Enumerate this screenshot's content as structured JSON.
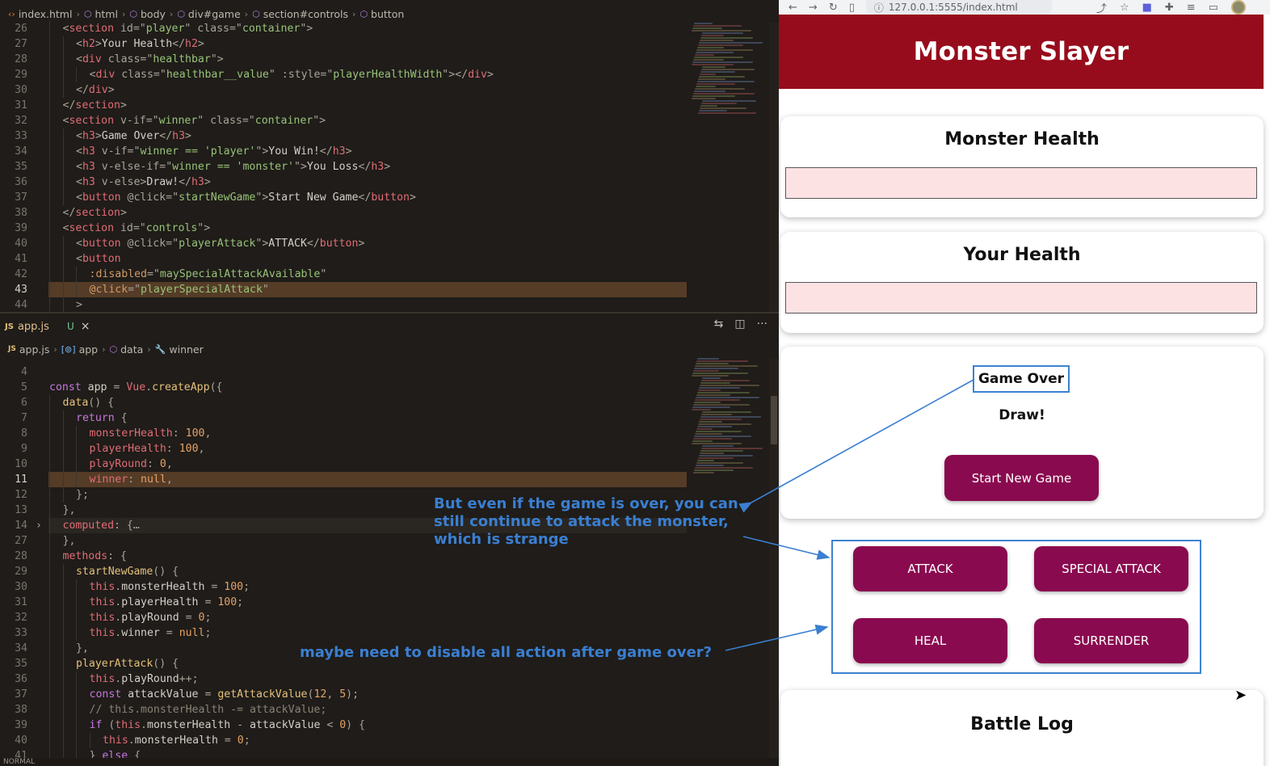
{
  "editor": {
    "top_breadcrumb": [
      {
        "icon": "html-icon",
        "label": "index.html"
      },
      {
        "icon": "box-icon",
        "label": "html"
      },
      {
        "icon": "box-icon",
        "label": "body"
      },
      {
        "icon": "box-icon",
        "label": "div#game"
      },
      {
        "icon": "box-icon",
        "label": "section#controls"
      },
      {
        "icon": "box-icon",
        "label": "button"
      }
    ],
    "html_lines": [
      {
        "n": "26",
        "code": "<section id=\"player\" class=\"container\">",
        "indent": 1
      },
      {
        "n": "27",
        "code": "<h2>Your Health</h2>",
        "indent": 2
      },
      {
        "n": "28",
        "code": "<div class=\"healthbar\">",
        "indent": 2
      },
      {
        "n": "29",
        "code": "<div class=\"healthbar__value\" :style=\"playerHealthWidth\"></div>",
        "indent": 3
      },
      {
        "n": "30",
        "code": "</div>",
        "indent": 2
      },
      {
        "n": "31",
        "code": "</section>",
        "indent": 1
      },
      {
        "n": "32",
        "code": "<section v-if=\"winner\" class=\"container\">",
        "indent": 1
      },
      {
        "n": "33",
        "code": "<h3>Game Over</h3>",
        "indent": 2
      },
      {
        "n": "34",
        "code": "<h3 v-if=\"winner == 'player'\">You Win!</h3>",
        "indent": 2
      },
      {
        "n": "35",
        "code": "<h3 v-else-if=\"winner == 'monster'\">You Loss</h3>",
        "indent": 2
      },
      {
        "n": "36",
        "code": "<h3 v-else>Draw!</h3>",
        "indent": 2
      },
      {
        "n": "37",
        "code": "<button @click=\"startNewGame\">Start New Game</button>",
        "indent": 2
      },
      {
        "n": "38",
        "code": "</section>",
        "indent": 1
      },
      {
        "n": "39",
        "code": "<section id=\"controls\">",
        "indent": 1
      },
      {
        "n": "40",
        "code": "<button @click=\"playerAttack\">ATTACK</button>",
        "indent": 2
      },
      {
        "n": "41",
        "code": "<button",
        "indent": 2
      },
      {
        "n": "42",
        "code": ":disabled=\"maySpecialAttackAvailable\"",
        "indent": 3
      },
      {
        "n": "43",
        "code": "@click=\"playerSpecialAttack\"",
        "indent": 3,
        "current": true
      },
      {
        "n": "44",
        "code": ">",
        "indent": 2
      }
    ],
    "tab": {
      "badge": "JS",
      "name": "app.js",
      "status": "U",
      "close": "×"
    },
    "tab_actions": [
      "⇆",
      "◫",
      "···"
    ],
    "js_breadcrumb": [
      {
        "icon": "js-icon",
        "label": "app.js"
      },
      {
        "icon": "variable-icon",
        "label": "app"
      },
      {
        "icon": "box-icon",
        "label": "data"
      },
      {
        "icon": "wrench-icon",
        "label": "winner"
      }
    ],
    "js_lines": [
      {
        "n": "4",
        "code": "",
        "indent": 0
      },
      {
        "n": "5",
        "code": "const app = Vue.createApp({",
        "indent": 0
      },
      {
        "n": "6",
        "code": "data() {",
        "indent": 1
      },
      {
        "n": "7",
        "code": "return {",
        "indent": 2
      },
      {
        "n": "8",
        "code": "monsterHealth: 100,",
        "indent": 3
      },
      {
        "n": "9",
        "code": "playerHealth: 100,",
        "indent": 3
      },
      {
        "n": "10",
        "code": "playRound: 0,",
        "indent": 3
      },
      {
        "n": "11",
        "code": "winner: null,",
        "indent": 3,
        "current": true
      },
      {
        "n": "12",
        "code": "};",
        "indent": 2
      },
      {
        "n": "13",
        "code": "},",
        "indent": 1
      },
      {
        "n": "14",
        "code": "computed: {…",
        "indent": 1,
        "fold": true
      },
      {
        "n": "27",
        "code": "},",
        "indent": 1
      },
      {
        "n": "28",
        "code": "methods: {",
        "indent": 1
      },
      {
        "n": "29",
        "code": "startNewGame() {",
        "indent": 2
      },
      {
        "n": "30",
        "code": "this.monsterHealth = 100;",
        "indent": 3
      },
      {
        "n": "31",
        "code": "this.playerHealth = 100;",
        "indent": 3
      },
      {
        "n": "32",
        "code": "this.playRound = 0;",
        "indent": 3
      },
      {
        "n": "33",
        "code": "this.winner = null;",
        "indent": 3
      },
      {
        "n": "34",
        "code": "},",
        "indent": 2
      },
      {
        "n": "35",
        "code": "playerAttack() {",
        "indent": 2
      },
      {
        "n": "36",
        "code": "this.playRound++;",
        "indent": 3
      },
      {
        "n": "37",
        "code": "const attackValue = getAttackValue(12, 5);",
        "indent": 3
      },
      {
        "n": "38",
        "code": "// this.monsterHealth -= attackValue;",
        "indent": 3
      },
      {
        "n": "39",
        "code": "if (this.monsterHealth - attackValue < 0) {",
        "indent": 3
      },
      {
        "n": "40",
        "code": "this.monsterHealth = 0;",
        "indent": 4
      },
      {
        "n": "41",
        "code": "} else {",
        "indent": 3
      }
    ],
    "status_text": "NORMAL"
  },
  "browser": {
    "url": "127.0.0.1:5555/index.html",
    "app_title": "Monster Slayer",
    "monster_health_title": "Monster Health",
    "monster_health_fraction": 0,
    "player_health_title": "Your Health",
    "player_health_fraction": 0,
    "game_over_title": "Game Over",
    "result_text": "Draw!",
    "start_new_game_label": "Start New Game",
    "controls": {
      "attack": "ATTACK",
      "special_attack": "SPECIAL ATTACK",
      "heal": "HEAL",
      "surrender": "SURRENDER"
    },
    "battle_log_title": "Battle Log"
  },
  "annotations": {
    "note1_line1": "But even if the game is over, you can",
    "note1_line2": "still continue to attack the monster,",
    "note1_line3": "which is strange",
    "note2": "maybe need to disable all action after game over?",
    "color": "#3a7fd1"
  }
}
